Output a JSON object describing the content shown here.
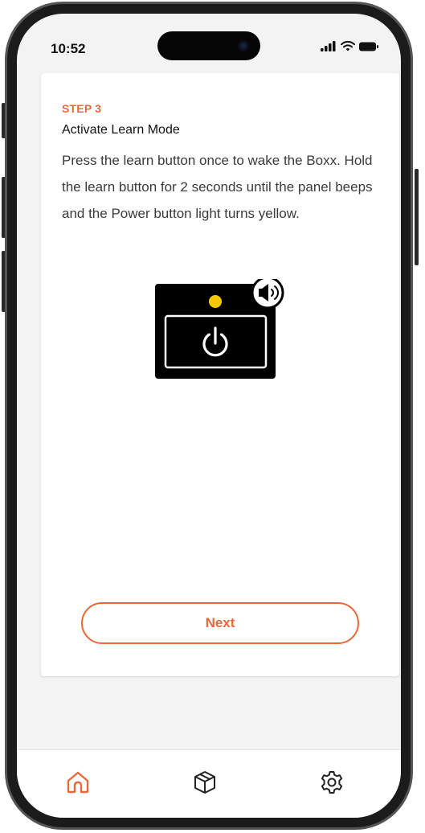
{
  "status_bar": {
    "time": "10:52",
    "icons": [
      "cellular-signal-icon",
      "wifi-icon",
      "battery-icon"
    ]
  },
  "step": {
    "label": "STEP 3",
    "title": "Activate Learn Mode",
    "description": "Press the learn button once to wake the Boxx. Hold the learn button for 2 seconds until the panel beeps and the Power button light turns yellow."
  },
  "illustration": {
    "icons": [
      "control-panel-icon",
      "indicator-light-icon",
      "power-icon",
      "speaker-sound-icon"
    ],
    "indicator_color": "#f5c800"
  },
  "actions": {
    "next_label": "Next"
  },
  "tab_bar": {
    "tabs": [
      {
        "name": "home",
        "icon": "home-icon",
        "active": true
      },
      {
        "name": "packages",
        "icon": "package-icon",
        "active": false
      },
      {
        "name": "settings",
        "icon": "gear-icon",
        "active": false
      }
    ]
  },
  "colors": {
    "accent": "#e8683a",
    "screen_background": "#f3f3f3",
    "card_background": "#ffffff"
  }
}
